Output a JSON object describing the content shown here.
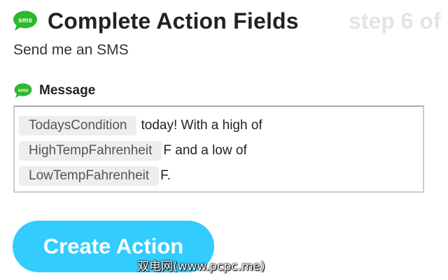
{
  "header": {
    "icon": "sms-icon",
    "icon_text": "sms",
    "title": "Complete Action Fields",
    "step": "step 6 of"
  },
  "subtitle": "Send me an SMS",
  "field": {
    "icon": "sms-icon",
    "label": "Message",
    "lines": [
      {
        "pill": "TodaysCondition",
        "text": "today! With a high of"
      },
      {
        "pill": "HighTempFahrenheit",
        "text": "F and a low of"
      },
      {
        "pill": "LowTempFahrenheit",
        "text": "F."
      }
    ]
  },
  "button": {
    "label": "Create Action"
  },
  "watermark": "双电网(www.pcpc.me)",
  "colors": {
    "sms_green": "#2eb82e",
    "button_blue": "#33ccff",
    "step_gray": "#e4e4e4",
    "pill_bg": "#eeeeee"
  }
}
